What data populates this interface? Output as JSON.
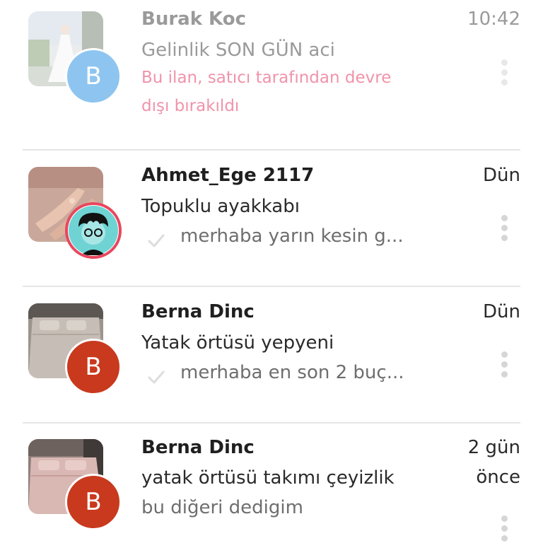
{
  "conversations": [
    {
      "name": "Burak Koc",
      "subject": "Gelinlik SON GÜN aci",
      "status_line_1": "Bu ilan, satıcı tarafından devre",
      "status_line_2": "dışı bırakıldı",
      "time": "10:42",
      "avatar_letter": "B",
      "avatar_color": "#8ec5f0",
      "status_color": "#f093a9",
      "thumbnail": "wedding-dress-photo"
    },
    {
      "name": "Ahmet_Ege 2117",
      "subject": "Topuklu ayakkabı",
      "preview": "merhaba yarın kesin g...",
      "time": "Dün",
      "avatar": "illustrated-character-avatar",
      "avatar_ring_color": "#e8475f",
      "thumbnail": "high-heel-shoes-photo"
    },
    {
      "name": "Berna Dinc",
      "subject": "Yatak örtüsü yepyeni",
      "preview": "merhaba en son 2 buç...",
      "time": "Dün",
      "avatar_letter": "B",
      "avatar_color": "#c9391d",
      "thumbnail": "bedspread-photo"
    },
    {
      "name": "Berna Dinc",
      "subject": "yatak örtüsü takımı çeyizlik",
      "preview": "bu diğeri dedigim",
      "time_line_1": "2 gün",
      "time_line_2": "önce",
      "avatar_letter": "B",
      "avatar_color": "#c9391d",
      "thumbnail": "bedspread-set-photo"
    }
  ],
  "icons": {
    "more": "more-vertical-icon",
    "sent": "check-icon"
  }
}
